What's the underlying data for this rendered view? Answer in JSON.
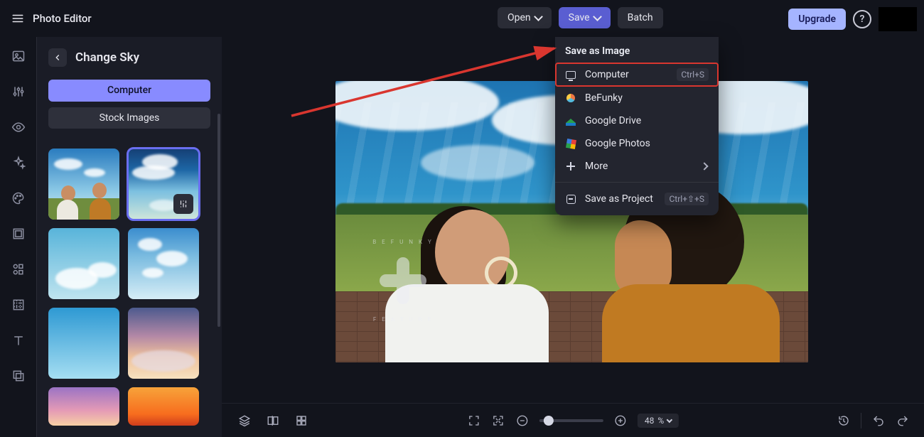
{
  "app": {
    "title": "Photo Editor"
  },
  "topbar": {
    "open_label": "Open",
    "save_label": "Save",
    "batch_label": "Batch",
    "upgrade_label": "Upgrade"
  },
  "save_menu": {
    "title": "Save as Image",
    "items": [
      {
        "label": "Computer",
        "shortcut": "Ctrl+S",
        "icon": "monitor-icon",
        "highlighted": true
      },
      {
        "label": "BeFunky",
        "icon": "befunky-icon"
      },
      {
        "label": "Google Drive",
        "icon": "google-drive-icon"
      },
      {
        "label": "Google Photos",
        "icon": "google-photos-icon"
      },
      {
        "label": "More",
        "icon": "plus-icon",
        "chevron": true
      }
    ],
    "project": {
      "label": "Save as Project",
      "shortcut": "Ctrl+⇧+S"
    }
  },
  "panel": {
    "title": "Change Sky",
    "tab_computer": "Computer",
    "tab_stock": "Stock Images"
  },
  "rail_icons": [
    "image-icon",
    "sliders-icon",
    "eye-icon",
    "sparkle-icon",
    "palette-icon",
    "frame-icon",
    "shapes-icon",
    "texture-icon",
    "text-icon",
    "layers-icon"
  ],
  "bottombar": {
    "zoom_pct": "48",
    "zoom_suffix": "%"
  },
  "colors": {
    "accent": "#6a6ef0",
    "upgrade_bg": "#a5b4ff",
    "highlight_red": "#d9362f"
  }
}
